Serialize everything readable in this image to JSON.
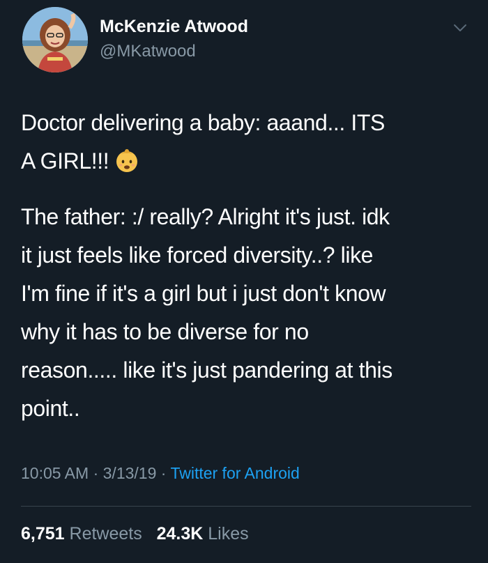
{
  "user": {
    "display_name": "McKenzie Atwood",
    "handle": "@MKatwood"
  },
  "tweet": {
    "paragraph1": [
      "Doctor delivering a baby: aaand... ITS",
      "A GIRL!!!"
    ],
    "emoji": "baby-emoji",
    "paragraph2": [
      "The father: :/ really? Alright it's just. idk",
      "it just feels like forced diversity..? like",
      "I'm fine if it's a girl but i just don't know",
      "why it has to be diverse for no",
      "reason..... like it's just pandering at this",
      "point.."
    ]
  },
  "meta": {
    "time": "10:05 AM",
    "date": "3/13/19",
    "separator": "·",
    "source": "Twitter for Android"
  },
  "stats": {
    "retweets_count": "6,751",
    "retweets_label": "Retweets",
    "likes_count": "24.3K",
    "likes_label": "Likes"
  },
  "colors": {
    "background": "#141d26",
    "text": "#ffffff",
    "secondary": "#8899a6",
    "link": "#1da1f2",
    "divider": "#38444d"
  },
  "icons": {
    "menu": "chevron-down-icon",
    "avatar": "avatar"
  }
}
